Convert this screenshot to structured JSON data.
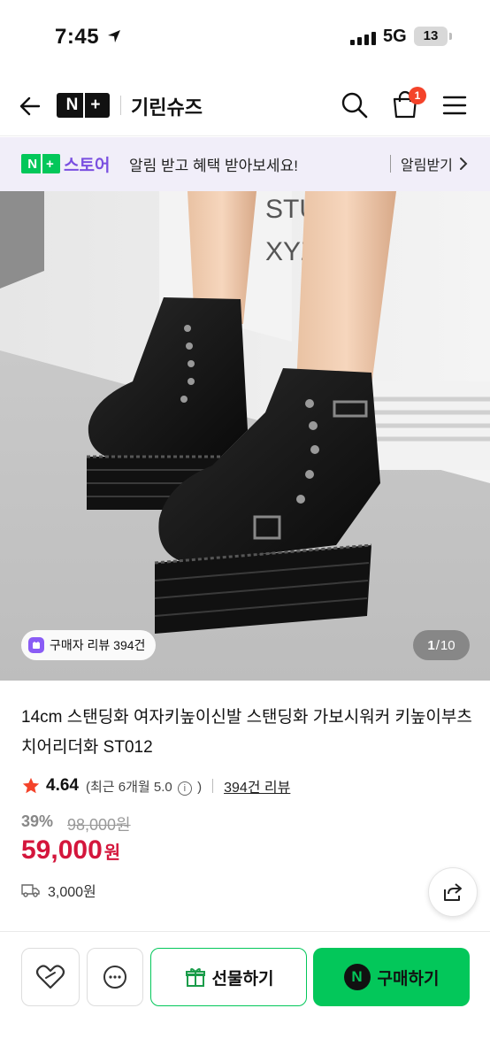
{
  "status_bar": {
    "time": "7:45",
    "network": "5G",
    "battery": "13"
  },
  "header": {
    "logo_text": "N",
    "logo_plus": "+",
    "store_name": "기린슈즈",
    "cart_count": "1"
  },
  "promo": {
    "badge_n": "N",
    "badge_plus": "+",
    "store_label": "스토어",
    "message": "알림 받고 혜택 받아보세요!",
    "action": "알림받기"
  },
  "gallery": {
    "review_chip": "구매자 리뷰 394건",
    "current_page": "1",
    "page_sep": "/",
    "total_pages": "10",
    "image_text_1": "STU",
    "image_text_2": "XYZ"
  },
  "product": {
    "title": "14cm 스탠딩화 여자키높이신발 스탠딩화 가보시워커 키높이부츠 치어리더화 ST012",
    "rating": "4.64",
    "recent_rating_prefix": "(최근 6개월 5.0",
    "info_glyph": "i",
    "recent_rating_suffix": ")",
    "review_count": "394건 리뷰",
    "discount": "39%",
    "original_price": "98,000원",
    "sale_price": "59,000",
    "sale_unit": "원",
    "shipping_fee": "3,000원"
  },
  "bottom_bar": {
    "gift_label": "선물하기",
    "buy_badge": "N",
    "buy_label": "구매하기"
  },
  "colors": {
    "naver_green": "#03c75a",
    "price_red": "#d4163c",
    "promo_purple": "#7a4fe0",
    "badge_red": "#f4432a"
  }
}
